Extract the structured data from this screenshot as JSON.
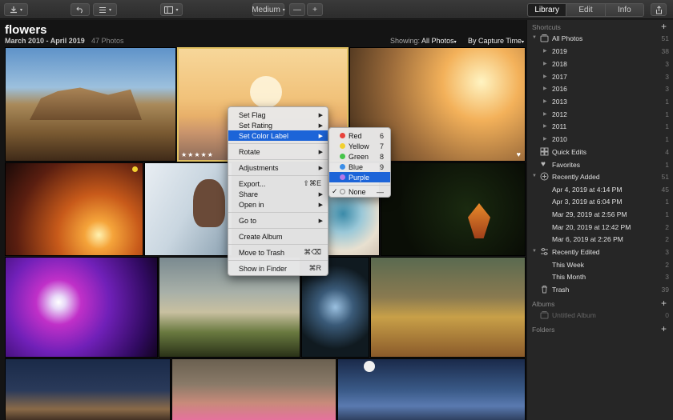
{
  "toolbar": {
    "zoom_label": "Medium",
    "zoom_out": "—",
    "zoom_in": "+",
    "mode_tabs": [
      "Library",
      "Edit",
      "Info"
    ],
    "active_mode": "Library"
  },
  "header": {
    "title": "flowers",
    "date_range": "March 2010 - April 2019",
    "count": "47 Photos",
    "showing_label": "Showing:",
    "showing_value": "All Photos",
    "sort_label": "By Capture Time"
  },
  "photo_stars": "★★★★★",
  "photo_heart": "♥",
  "context_menu": {
    "items": [
      "Set Flag",
      "Set Rating",
      "Set Color Label",
      "Rotate",
      "Adjustments",
      "Export...",
      "Share",
      "Open in",
      "Go to",
      "Create Album",
      "Move to Trash",
      "Show in Finder"
    ],
    "shortcuts": {
      "export": "⇧⌘E",
      "trash": "⌘⌫",
      "finder": "⌘R"
    },
    "submenu_arrow": "▶"
  },
  "color_submenu": {
    "items": [
      {
        "label": "Red",
        "key": "6",
        "color": "#e8433b"
      },
      {
        "label": "Yellow",
        "key": "7",
        "color": "#f2d030"
      },
      {
        "label": "Green",
        "key": "8",
        "color": "#45c44a"
      },
      {
        "label": "Blue",
        "key": "9",
        "color": "#3b8ee8"
      },
      {
        "label": "Purple",
        "key": "",
        "color": "#b377e8"
      }
    ],
    "none_label": "None",
    "none_key": "—",
    "check": "✓"
  },
  "sidebar": {
    "shortcuts_label": "Shortcuts",
    "all_photos": {
      "label": "All Photos",
      "count": "51"
    },
    "years": [
      {
        "label": "2019",
        "count": "38"
      },
      {
        "label": "2018",
        "count": "3"
      },
      {
        "label": "2017",
        "count": "3"
      },
      {
        "label": "2016",
        "count": "3"
      },
      {
        "label": "2013",
        "count": "1"
      },
      {
        "label": "2012",
        "count": "1"
      },
      {
        "label": "2011",
        "count": "1"
      },
      {
        "label": "2010",
        "count": "1"
      }
    ],
    "quick_edits": {
      "label": "Quick Edits",
      "count": "4"
    },
    "favorites": {
      "label": "Favorites",
      "count": "1"
    },
    "recently_added": {
      "label": "Recently Added",
      "count": "51"
    },
    "recent_dates": [
      {
        "label": "Apr 4, 2019 at 4:14 PM",
        "count": "45"
      },
      {
        "label": "Apr 3, 2019 at 6:04 PM",
        "count": "1"
      },
      {
        "label": "Mar 29, 2019 at 2:56 PM",
        "count": "1"
      },
      {
        "label": "Mar 20, 2019 at 12:42 PM",
        "count": "2"
      },
      {
        "label": "Mar 6, 2019 at 2:26 PM",
        "count": "2"
      }
    ],
    "recently_edited": {
      "label": "Recently Edited",
      "count": "3"
    },
    "edited_items": [
      {
        "label": "This Week",
        "count": "2"
      },
      {
        "label": "This Month",
        "count": "3"
      }
    ],
    "trash": {
      "label": "Trash",
      "count": "39"
    },
    "albums_label": "Albums",
    "untitled_album": {
      "label": "Untitled Album",
      "count": "0"
    },
    "folders_label": "Folders",
    "plus": "+",
    "expand_tri": "▼",
    "collapse_tri": "▶"
  }
}
